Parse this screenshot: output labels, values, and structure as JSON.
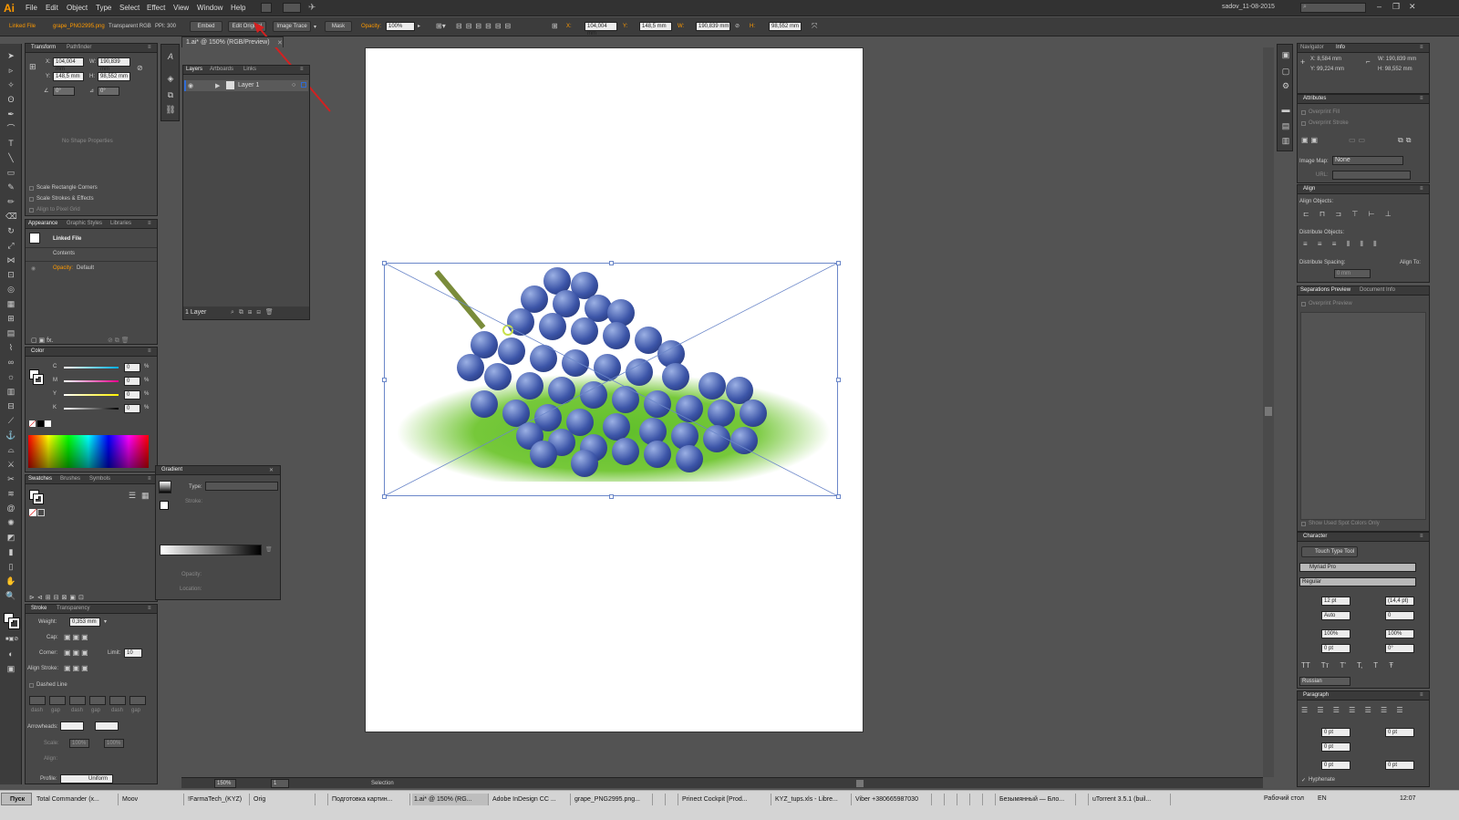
{
  "menubar": {
    "logo": "Ai",
    "items": [
      "File",
      "Edit",
      "Object",
      "Type",
      "Select",
      "Effect",
      "View",
      "Window",
      "Help"
    ],
    "workspace": "sadov_11-08-2015"
  },
  "control": {
    "linked_file": "Linked File",
    "filename": "grape_PNG2995.png",
    "colormode": "Transparent RGB",
    "ppi": "PPI: 300",
    "embed": "Embed",
    "edit_original": "Edit Original",
    "image_trace": "Image Trace",
    "mask": "Mask",
    "opacity_label": "Opacity:",
    "opacity": "100%",
    "x_label": "X:",
    "x": "104,004 mm",
    "y_label": "Y:",
    "y": "148,5 mm",
    "w_label": "W:",
    "w": "190,839 mm",
    "h_label": "H:",
    "h": "98,552 mm"
  },
  "document": {
    "tab_title": "1.ai* @ 150% (RGB/Preview)",
    "zoom": "150%",
    "page": "1",
    "status": "Selection"
  },
  "transform": {
    "tabs": [
      "Transform",
      "Pathfinder"
    ],
    "x": "104,004 mm",
    "y": "148,5 mm",
    "w": "190,839 mm",
    "h": "98,552 mm",
    "angle": "0°",
    "shear": "0°",
    "no_shape": "No Shape Properties",
    "scale_corners": "Scale Rectangle Corners",
    "scale_strokes": "Scale Strokes & Effects",
    "align_pixel": "Align to Pixel Grid"
  },
  "layers": {
    "tabs": [
      "Layers",
      "Artboards",
      "Links"
    ],
    "layer_name": "Layer 1",
    "count": "1 Layer"
  },
  "appearance": {
    "tabs": [
      "Appearance",
      "Graphic Styles",
      "Libraries"
    ],
    "linked_file": "Linked File",
    "contents": "Contents",
    "opacity_label": "Opacity:",
    "opacity_value": "Default"
  },
  "color": {
    "tab": "Color",
    "channels": [
      {
        "name": "C",
        "value": "0",
        "color": "#00aeef"
      },
      {
        "name": "M",
        "value": "0",
        "color": "#ec008c"
      },
      {
        "name": "Y",
        "value": "0",
        "color": "#fff200"
      },
      {
        "name": "K",
        "value": "0",
        "color": "#000000"
      }
    ],
    "percent": "%"
  },
  "swatches": {
    "tabs": [
      "Swatches",
      "Brushes",
      "Symbols"
    ]
  },
  "gradient": {
    "tab": "Gradient",
    "type_label": "Type:",
    "stroke_label": "Stroke:",
    "opacity_label": "Opacity:",
    "location_label": "Location:"
  },
  "stroke": {
    "tabs": [
      "Stroke",
      "Transparency"
    ],
    "weight_label": "Weight:",
    "weight": "0,353 mm",
    "cap_label": "Cap:",
    "corner_label": "Corner:",
    "limit_label": "Limit:",
    "limit": "10",
    "align_label": "Align Stroke:",
    "dashed": "Dashed Line",
    "dash_labels": [
      "dash",
      "gap",
      "dash",
      "gap",
      "dash",
      "gap"
    ],
    "arrowheads_label": "Arrowheads:",
    "scale_label": "Scale:",
    "scale1": "100%",
    "scale2": "100%",
    "align2_label": "Align:",
    "profile_label": "Profile:",
    "profile": "Uniform"
  },
  "info": {
    "tabs": [
      "Navigator",
      "Info"
    ],
    "x": "X: 8,584 mm",
    "y": "Y: 99,224 mm",
    "w": "W: 190,839 mm",
    "h": "H: 98,552 mm"
  },
  "attributes": {
    "tab": "Attributes",
    "overprint_fill": "Overprint Fill",
    "overprint_stroke": "Overprint Stroke",
    "image_map_label": "Image Map:",
    "image_map": "None",
    "url_label": "URL:"
  },
  "align": {
    "tab": "Align",
    "align_objects": "Align Objects:",
    "distribute_objects": "Distribute Objects:",
    "distribute_spacing": "Distribute Spacing:",
    "align_to": "Align To:",
    "spacing": "0 mm"
  },
  "separations": {
    "tabs": [
      "Separations Preview",
      "Document Info"
    ],
    "overprint_preview": "Overprint Preview",
    "show_spot": "Show Used Spot Colors Only"
  },
  "character": {
    "tab": "Character",
    "touch_type": "Touch Type Tool",
    "font": "Myriad Pro",
    "style": "Regular",
    "size": "12 pt",
    "leading": "(14,4 pt)",
    "kerning": "Auto",
    "tracking": "0",
    "vscale": "100%",
    "hscale": "100%",
    "baseline": "0 pt",
    "rotation": "0°",
    "language": "Russian"
  },
  "paragraph": {
    "tab": "Paragraph",
    "indent1": "0 pt",
    "indent2": "0 pt",
    "indent3": "0 pt",
    "space1": "0 pt",
    "space2": "0 pt",
    "hyphenate": "Hyphenate"
  },
  "taskbar": {
    "start": "Пуск",
    "items": [
      "Total Commander (x...",
      "Moov",
      "!FarmaTech_(KYZ)",
      "Orig",
      "",
      "Подготовка картин...",
      "1.ai* @ 150% (RG...",
      "Adobe InDesign CC ...",
      "grape_PNG2995.png...",
      "",
      "",
      "Prinect Cockpit [Prod...",
      "KYZ_tups.xls - Libre...",
      "Viber +380665987030",
      "",
      "",
      "",
      "",
      "",
      "Безымянный — Бло...",
      "",
      "uTorrent 3.5.1 (buil..."
    ],
    "desktop": "Рабочий стол",
    "lang": "EN",
    "time": "12:07"
  }
}
